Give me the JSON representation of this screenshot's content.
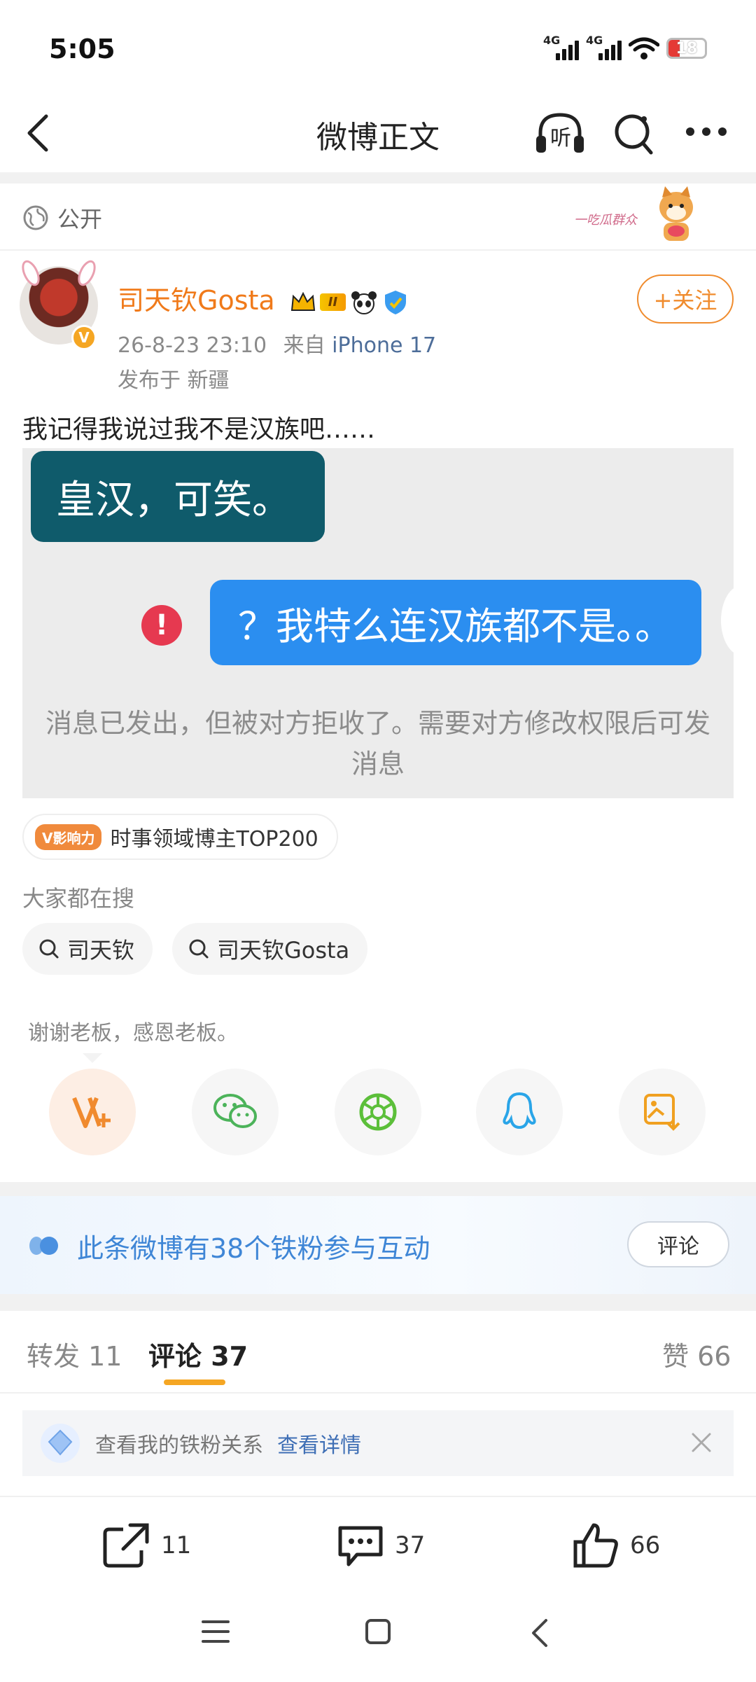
{
  "status_bar": {
    "time": "5:05",
    "network1": "4G",
    "network2": "4G",
    "battery": "18",
    "battery_color": "#e53935"
  },
  "nav": {
    "title": "微博正文",
    "back_icon": "back-arrow-icon",
    "listen_label": "听",
    "search_icon": "search-icon",
    "more_icon": "more-icon"
  },
  "visibility": {
    "label": "公开",
    "sticker_text": "一吃瓜群众"
  },
  "author": {
    "name": "司天钦Gosta",
    "level_badge": "II",
    "time": "26-8-23 23:10",
    "source_prefix": "来自",
    "source": "iPhone 17",
    "location": "发布于 新疆",
    "follow_label": "+关注",
    "verified_badge": "V"
  },
  "post": {
    "text": "我记得我说过我不是汉族吧……"
  },
  "embedded_image": {
    "bubble_left": "皇汉，可笑。",
    "bubble_right": "？我特么连汉族都不是。。",
    "error_mark": "!",
    "notice_line1": "消息已发出，但被对方拒收了。需要对方修改权限后可发",
    "notice_line2": "消息"
  },
  "influence": {
    "badge": "V影响力",
    "label": "时事领域博主TOP200"
  },
  "search_section": {
    "header": "大家都在搜",
    "chips": [
      "司天钦",
      "司天钦Gosta"
    ]
  },
  "thanks_text": "谢谢老板，感恩老板。",
  "share_buttons": [
    "v-plus-icon",
    "wechat-icon",
    "moments-icon",
    "qq-icon",
    "save-image-icon"
  ],
  "fans_banner": {
    "text": "此条微博有38个铁粉参与互动",
    "button": "评论"
  },
  "tabs": {
    "repost": "转发 11",
    "comment": "评论 37",
    "like": "赞 66"
  },
  "fan_relation": {
    "text": "查看我的铁粉关系",
    "link": "查看详情"
  },
  "bottom_actions": {
    "repost_count": "11",
    "comment_count": "37",
    "like_count": "66"
  },
  "colors": {
    "accent_orange": "#f07a1a",
    "link_blue": "#3f86d6",
    "bubble_teal": "#0f5b6b",
    "bubble_blue": "#2b8ef0"
  }
}
